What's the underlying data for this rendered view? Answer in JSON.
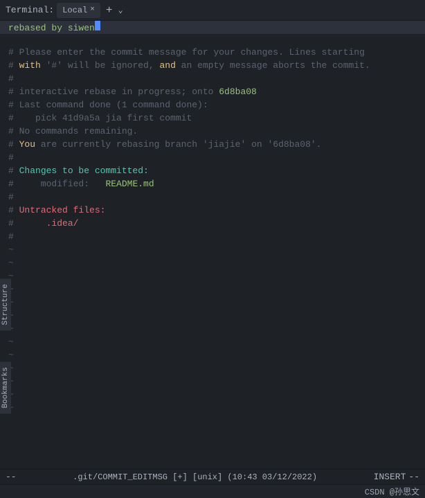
{
  "terminal": {
    "label": "Terminal:",
    "tab_name": "Local",
    "close_icon": "×",
    "add_icon": "+",
    "dropdown_icon": "⌄"
  },
  "editor": {
    "first_line": {
      "text": "rebased by siwen",
      "cursor": true
    },
    "lines": [
      {
        "type": "empty",
        "text": ""
      },
      {
        "type": "comment",
        "text": "# Please enter the commit message for your changes. Lines starting"
      },
      {
        "type": "comment",
        "text": "# with '#' will be ignored, and an empty message aborts the commit."
      },
      {
        "type": "comment",
        "text": "#"
      },
      {
        "type": "comment",
        "text": "# interactive rebase in progress; onto 6d8ba08"
      },
      {
        "type": "comment",
        "text": "# Last command done (1 command done):"
      },
      {
        "type": "comment_pick",
        "text": "#    pick 41d9a5a jia first commit"
      },
      {
        "type": "comment",
        "text": "# No commands remaining."
      },
      {
        "type": "comment_branch",
        "text": "# You are currently rebasing branch 'jiajie' on '6d8ba08'."
      },
      {
        "type": "comment",
        "text": "#"
      },
      {
        "type": "comment_changes",
        "text": "# Changes to be committed:"
      },
      {
        "type": "comment_modified",
        "text": "#     modified:   README.md"
      },
      {
        "type": "comment",
        "text": "#"
      },
      {
        "type": "comment_untracked",
        "text": "# Untracked files:"
      },
      {
        "type": "comment_idea",
        "text": "#      .idea/"
      },
      {
        "type": "comment",
        "text": "#"
      },
      {
        "type": "tilde"
      },
      {
        "type": "tilde"
      },
      {
        "type": "tilde"
      },
      {
        "type": "tilde"
      },
      {
        "type": "tilde"
      },
      {
        "type": "tilde"
      },
      {
        "type": "tilde"
      },
      {
        "type": "tilde"
      },
      {
        "type": "tilde"
      },
      {
        "type": "tilde"
      },
      {
        "type": "tilde"
      },
      {
        "type": "tilde"
      },
      {
        "type": "tilde"
      }
    ]
  },
  "mode_bar": {
    "left": "--",
    "mode": "INSERT",
    "right": "--"
  },
  "file_info": {
    "path": ".git/COMMIT_EDITMSG",
    "flags": "[+] [unix] (10:43 03/12/2022)"
  },
  "status_bar": {
    "right": "CSDN @孙思文"
  },
  "side_tabs": {
    "structure": "Structure",
    "bookmarks": "Bookmarks"
  }
}
